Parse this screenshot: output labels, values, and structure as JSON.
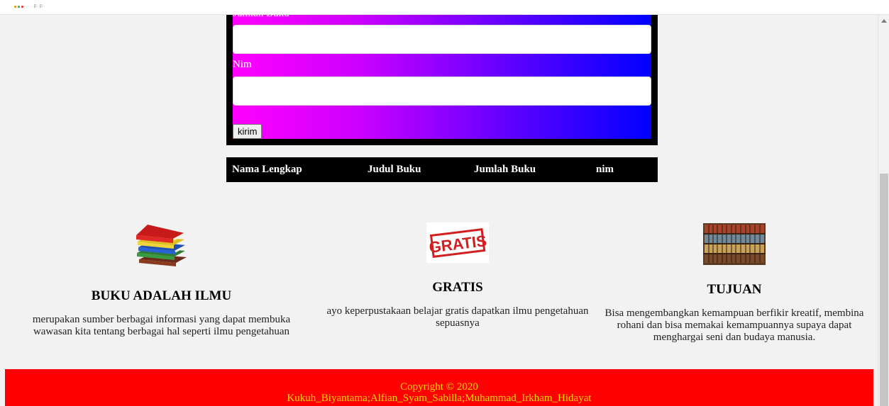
{
  "topbar": {
    "label": "· ·p·p·"
  },
  "form": {
    "cut_label": "Jumlah Buku",
    "nim_label": "Nim",
    "submit_label": "kirim"
  },
  "table": {
    "headers": [
      "Nama Lengkap",
      "Judul Buku",
      "Jumlah Buku",
      "nim"
    ]
  },
  "features": [
    {
      "title": "BUKU ADALAH ILMU",
      "text": "merupakan sumber berbagai informasi yang dapat membuka wawasan kita tentang berbagai hal seperti ilmu pengetahuan",
      "image": "books-stack"
    },
    {
      "title": "GRATIS",
      "text": "ayo keperpustakaan belajar gratis dapatkan ilmu pengetahuan sepuasnya",
      "image": "gratis-stamp",
      "stamp_text": "GRATIS"
    },
    {
      "title": "TUJUAN",
      "text": "Bisa mengembangkan kemampuan berfikir kreatif, membina rohani dan bisa memakai kemampuannya supaya dapat menghargai seni dan budaya manusia.",
      "image": "bookshelf"
    }
  ],
  "footer": {
    "copyright": "Copyright © 2020",
    "authors": "Kukuh_Biyantama;Alfian_Syam_Sabilla;Muhammad_Irkham_Hidayat"
  },
  "colors": {
    "form_gradient_start": "#ff00ff",
    "form_gradient_end": "#0000ff",
    "footer_bg": "#ff0000",
    "footer_text": "#ffd700",
    "table_header_bg": "#000000"
  }
}
